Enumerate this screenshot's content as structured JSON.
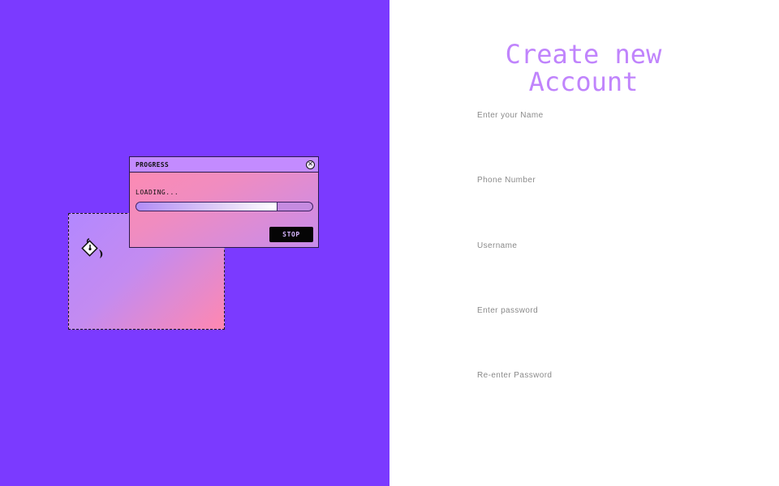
{
  "progress_window": {
    "title": "PROGRESS",
    "close_icon": "close-icon",
    "loading_text": "LOADING...",
    "progress_fraction": 0.8,
    "stop_label": "STOP"
  },
  "decoration": {
    "icon": "paint-bucket-icon"
  },
  "form": {
    "title_line1": "Create new",
    "title_line2": "Account",
    "fields": [
      {
        "label": "Enter your Name",
        "value": ""
      },
      {
        "label": "Phone Number",
        "value": ""
      },
      {
        "label": "Username",
        "value": ""
      },
      {
        "label": "Enter password",
        "value": ""
      },
      {
        "label": "Re-enter Password",
        "value": ""
      }
    ]
  },
  "colors": {
    "left_background": "#7b3aff",
    "title_color": "#c084fc",
    "stop_button_bg": "#050505"
  }
}
